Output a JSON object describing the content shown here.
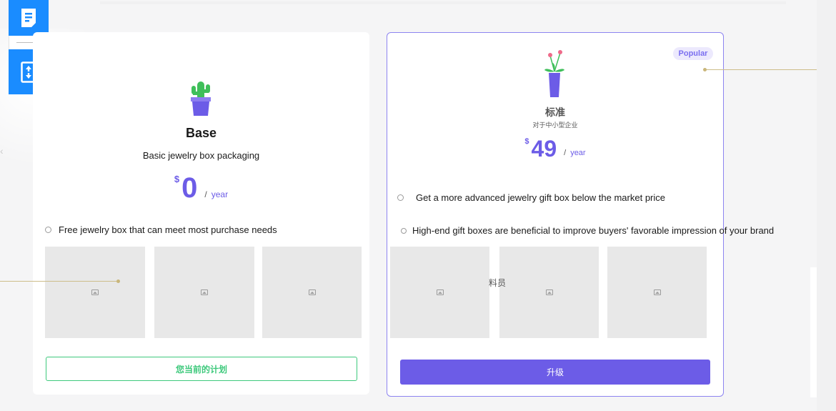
{
  "plans": {
    "base": {
      "name": "Base",
      "description": "Basic jewelry box packaging",
      "currency": "$",
      "price": "0",
      "period": "year",
      "features": [
        "Free jewelry box that can meet most purchase needs"
      ],
      "button_label": "您当前的计划"
    },
    "standard": {
      "badge": "Popular",
      "name": "标准",
      "subtitle": "对于中小型企业",
      "currency": "$",
      "price": "49",
      "period": "year",
      "features": [
        "Get a more advanced jewelry gift box below the market price",
        "High-end gift boxes are beneficial to improve buyers' favorable impression of your brand"
      ],
      "button_label": "升级"
    }
  },
  "overlap_text": "料员",
  "colors": {
    "accent": "#6c5ce7",
    "success": "#3ec97c",
    "toolbar": "#1a8cff"
  },
  "icons": {
    "toolbar": [
      "document-icon",
      "sort-icon"
    ],
    "base_plan": "cactus-pot-icon",
    "standard_plan": "flower-vase-icon",
    "placeholder": "image-icon"
  }
}
